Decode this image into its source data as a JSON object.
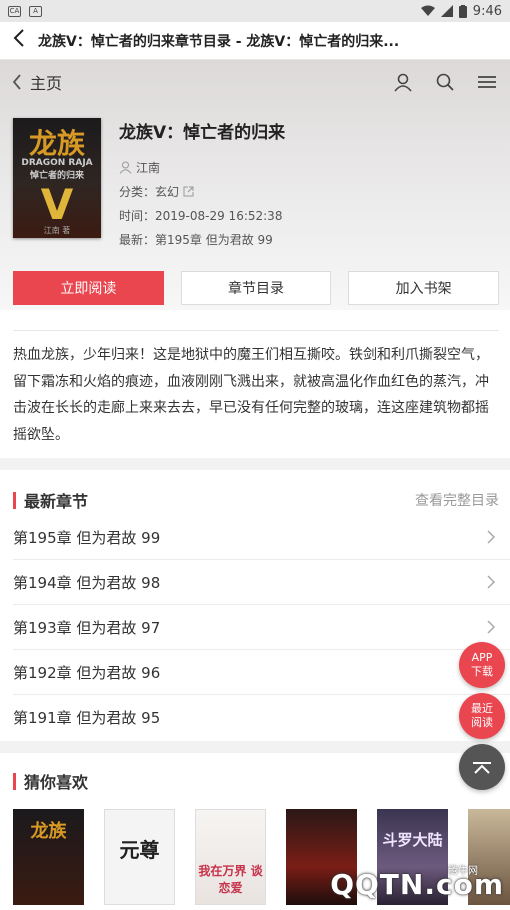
{
  "statusbar": {
    "time": "9:46",
    "left_icon_1": "CA",
    "left_icon_2": "A"
  },
  "titlebar": {
    "back_glyph": "‹",
    "title": "龙族V：悼亡者的归来章节目录 - 龙族V：悼亡者的归来..."
  },
  "nav": {
    "back_glyph": "‹",
    "home": "主页"
  },
  "book": {
    "title": "龙族V：悼亡者的归来",
    "author": "江南",
    "category": "分类：玄幻",
    "time": "时间：2019-08-29 16:52:38",
    "latest": "最新：第195章 但为君故 99",
    "cover": {
      "title": "龙族",
      "subtitle": "DRAGON RAJA",
      "subtitle2": "悼亡者的归来",
      "letter": "V",
      "author": "江南 著"
    }
  },
  "buttons": {
    "read": "立即阅读",
    "toc": "章节目录",
    "shelf": "加入书架"
  },
  "description": "热血龙族，少年归来！这是地狱中的魔王们相互撕咬。铁剑和利爪撕裂空气，留下霜冻和火焰的痕迹，血液刚刚飞溅出来，就被高温化作血红色的蒸汽，冲击波在长长的走廊上来来去去，早已没有任何完整的玻璃，连这座建筑物都摇摇欲坠。",
  "latest_section": {
    "title": "最新章节",
    "more": "查看完整目录"
  },
  "chapters": [
    {
      "title": "第195章 但为君故 99"
    },
    {
      "title": "第194章 但为君故 98"
    },
    {
      "title": "第193章 但为君故 97"
    },
    {
      "title": "第192章 但为君故 96"
    },
    {
      "title": "第191章 但为君故 95"
    }
  ],
  "recommend_section": {
    "title": "猜你喜欢"
  },
  "recommend_covers": [
    {
      "text": "龙族"
    },
    {
      "text": "元尊"
    },
    {
      "text": "我在万界 谈恋爱"
    },
    {
      "text": ""
    },
    {
      "text": "斗罗大陆"
    },
    {
      "text": ""
    }
  ],
  "fabs": {
    "app": "APP",
    "app2": "下载",
    "recent": "最近",
    "recent2": "阅读",
    "top_glyph": "⌃"
  },
  "watermark": {
    "logo": "QQTN.com",
    "small": "腾牛网"
  },
  "colors": {
    "accent": "#e9464f",
    "hero_bg": "#e3e0df"
  }
}
